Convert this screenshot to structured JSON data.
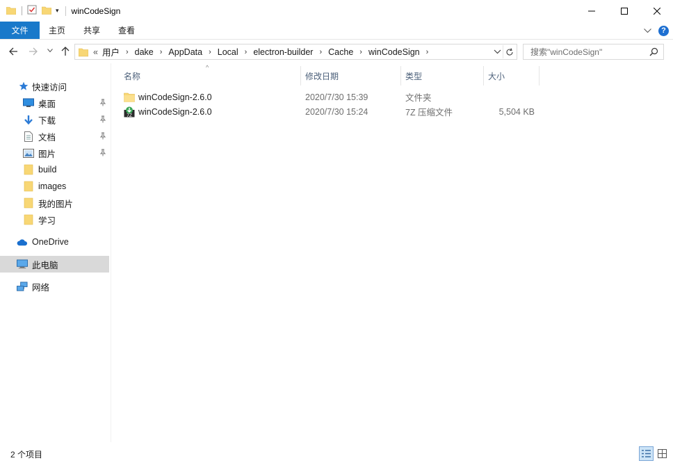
{
  "window": {
    "title": "winCodeSign",
    "controls": [
      "minimize",
      "maximize",
      "close"
    ]
  },
  "ribbon": {
    "tabs": [
      {
        "label": "文件",
        "active": true
      },
      {
        "label": "主页"
      },
      {
        "label": "共享"
      },
      {
        "label": "查看"
      }
    ],
    "help_label": "?"
  },
  "address_bar": {
    "overflow": "«",
    "crumbs": [
      "用户",
      "dake",
      "AppData",
      "Local",
      "electron-builder",
      "Cache",
      "winCodeSign"
    ]
  },
  "search": {
    "placeholder": "搜索\"winCodeSign\""
  },
  "nav_pane": {
    "items": [
      {
        "label": "快速访问",
        "icon": "star-icon"
      },
      {
        "label": "桌面",
        "icon": "desktop-icon",
        "pinned": true
      },
      {
        "label": "下载",
        "icon": "download-icon",
        "pinned": true
      },
      {
        "label": "文档",
        "icon": "document-icon",
        "pinned": true
      },
      {
        "label": "图片",
        "icon": "pictures-icon",
        "pinned": true
      },
      {
        "label": "build",
        "icon": "folder-icon"
      },
      {
        "label": "images",
        "icon": "folder-icon"
      },
      {
        "label": "我的图片",
        "icon": "folder-icon"
      },
      {
        "label": "学习",
        "icon": "folder-icon"
      },
      {
        "label": "OneDrive",
        "icon": "cloud-icon"
      },
      {
        "label": "此电脑",
        "icon": "computer-icon",
        "selected": true
      },
      {
        "label": "网络",
        "icon": "network-icon"
      }
    ]
  },
  "columns": [
    {
      "label": "名称"
    },
    {
      "label": "修改日期"
    },
    {
      "label": "类型"
    },
    {
      "label": "大小"
    }
  ],
  "files": [
    {
      "name": "winCodeSign-2.6.0",
      "date": "2020/7/30 15:39",
      "type": "文件夹",
      "size": "",
      "icon": "folder-icon"
    },
    {
      "name": "winCodeSign-2.6.0",
      "date": "2020/7/30 15:24",
      "type": "7Z 压缩文件",
      "size": "5,504 KB",
      "icon": "archive-7z-icon"
    }
  ],
  "status": {
    "count": "2 个项目"
  },
  "colors": {
    "accent": "#1979ca",
    "folder": "#f8d775",
    "selected_bg": "#d9d9d9"
  }
}
